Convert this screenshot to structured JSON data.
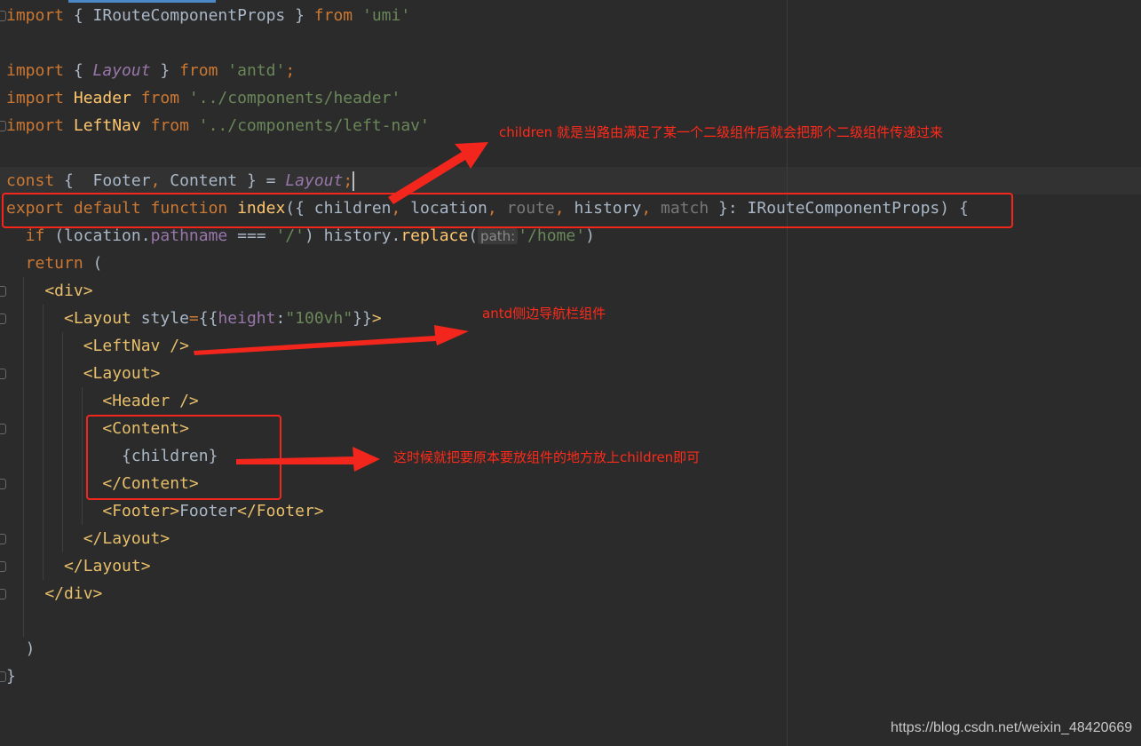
{
  "editor": {
    "lines": [
      [
        [
          "import ",
          "kw"
        ],
        [
          "{ IRouteComponentProps } ",
          "plain"
        ],
        [
          "from ",
          "kw"
        ],
        [
          "'umi'",
          "str"
        ]
      ],
      [],
      [
        [
          "import ",
          "kw"
        ],
        [
          "{ ",
          "plain"
        ],
        [
          "Layout",
          "pur it"
        ],
        [
          " } ",
          "plain"
        ],
        [
          "from ",
          "kw"
        ],
        [
          "'antd'",
          "str"
        ],
        [
          ";",
          "kw"
        ]
      ],
      [
        [
          "import ",
          "kw"
        ],
        [
          "Header ",
          "fn"
        ],
        [
          "from ",
          "kw"
        ],
        [
          "'../components/header'",
          "str"
        ]
      ],
      [
        [
          "import ",
          "kw"
        ],
        [
          "LeftNav ",
          "fn"
        ],
        [
          "from ",
          "kw"
        ],
        [
          "'../components/left-nav'",
          "str"
        ]
      ],
      [],
      [
        [
          "const ",
          "kw"
        ],
        [
          "{  Footer",
          "plain"
        ],
        [
          ", ",
          "kw"
        ],
        [
          "Content } = ",
          "plain"
        ],
        [
          "Layout",
          "pur it"
        ],
        [
          ";",
          "kw"
        ]
      ],
      [
        [
          "export default function ",
          "kw"
        ],
        [
          "index",
          "fn"
        ],
        [
          "({ children",
          "plain"
        ],
        [
          ", ",
          "kw"
        ],
        [
          "location",
          "plain"
        ],
        [
          ", ",
          "kw"
        ],
        [
          "route",
          "dim"
        ],
        [
          ", ",
          "kw"
        ],
        [
          "history",
          "plain"
        ],
        [
          ", ",
          "kw"
        ],
        [
          "match",
          "dim"
        ],
        [
          " }: IRouteComponentProps) {",
          "plain"
        ]
      ],
      [
        [
          "  if ",
          "kw"
        ],
        [
          "(location.",
          "plain"
        ],
        [
          "pathname",
          "pur"
        ],
        [
          " === ",
          "plain"
        ],
        [
          "'/'",
          "str"
        ],
        [
          ") history.",
          "plain"
        ],
        [
          "replace",
          "fn"
        ],
        [
          "(",
          "plain"
        ],
        [
          "path:",
          "hint"
        ],
        [
          "'/home'",
          "str"
        ],
        [
          ")",
          "plain"
        ]
      ],
      [
        [
          "  return ",
          "kw"
        ],
        [
          "(",
          "plain"
        ]
      ],
      [
        [
          "    <div>",
          "tag"
        ]
      ],
      [
        [
          "      <Layout ",
          "tag"
        ],
        [
          "style",
          "plain"
        ],
        [
          "=",
          "kw"
        ],
        [
          "{{",
          "plain"
        ],
        [
          "height",
          "pur"
        ],
        [
          ":",
          "plain"
        ],
        [
          "\"100vh\"",
          "str"
        ],
        [
          "}}",
          "plain"
        ],
        [
          ">",
          "tag"
        ]
      ],
      [
        [
          "        <LeftNav />",
          "tag"
        ]
      ],
      [
        [
          "        <Layout>",
          "tag"
        ]
      ],
      [
        [
          "          <Header />",
          "tag"
        ]
      ],
      [
        [
          "          <Content>",
          "tag"
        ]
      ],
      [
        [
          "            {children}",
          "plain"
        ]
      ],
      [
        [
          "          </Content>",
          "tag"
        ]
      ],
      [
        [
          "          <Footer>",
          "tag"
        ],
        [
          "Footer",
          "plain"
        ],
        [
          "</Footer>",
          "tag"
        ]
      ],
      [
        [
          "        </Layout>",
          "tag"
        ]
      ],
      [
        [
          "      </Layout>",
          "tag"
        ]
      ],
      [
        [
          "    </div>",
          "tag"
        ]
      ],
      [],
      [
        [
          "  )",
          "plain"
        ]
      ],
      [
        [
          "}",
          "plain"
        ]
      ]
    ]
  },
  "annotations": {
    "children_note": "children 就是当路由满足了某一个二级组件后就会把那个二级组件传递过来",
    "leftnav_note": "antd侧边导航栏组件",
    "content_note": "这时候就把要原本要放组件的地方放上children即可"
  },
  "watermark": "https://blog.csdn.net/weixin_48420669",
  "colors": {
    "annotation": "#f2261c",
    "background": "#2b2b2b",
    "keyword": "#cc7832",
    "string": "#6a8759",
    "tag": "#e8bf6a"
  }
}
